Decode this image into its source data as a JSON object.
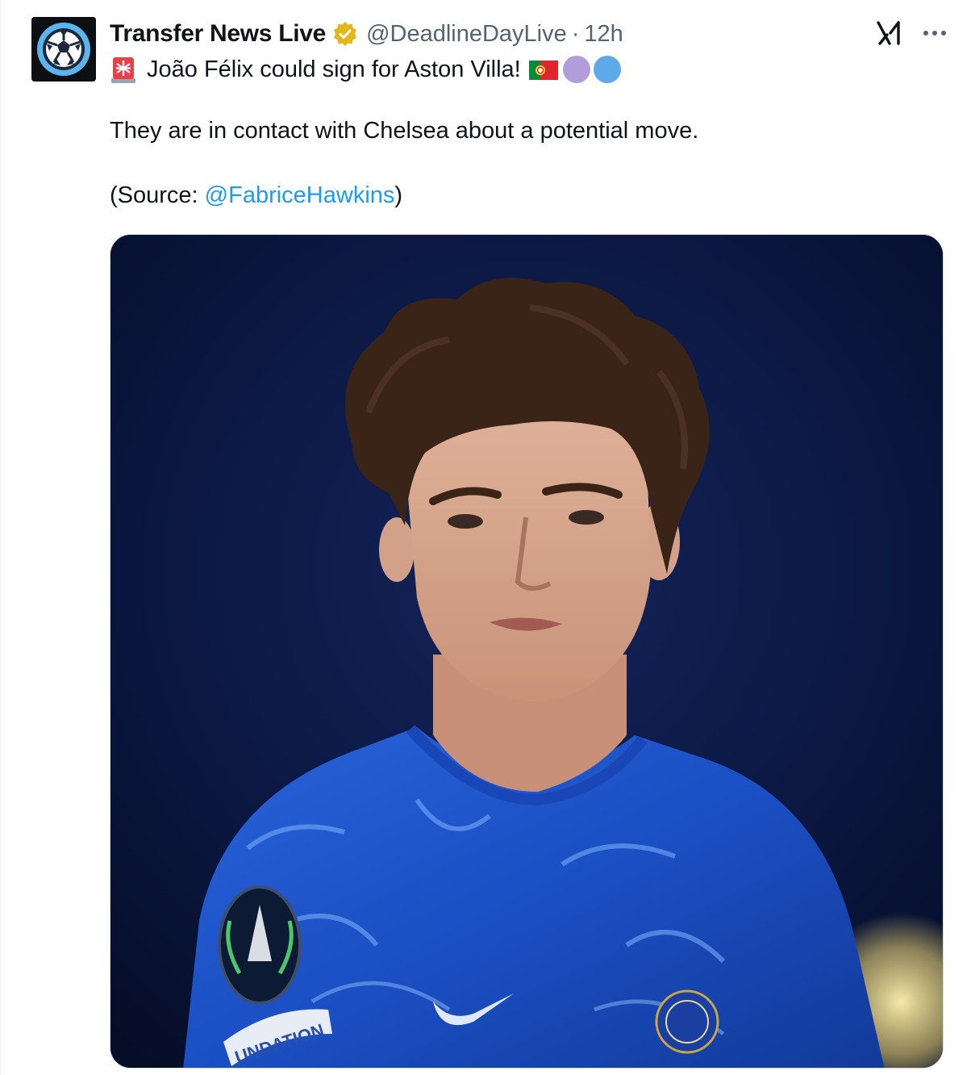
{
  "tweet": {
    "author": {
      "display_name": "Transfer News Live",
      "handle": "@DeadlineDayLive",
      "separator": "·",
      "time": "12h",
      "verified_color": "#e2b719"
    },
    "line1_text": "João Félix could sign for Aston Villa!",
    "paragraph1": "They are in contact with Chelsea about a potential move.",
    "source_prefix": "(Source: ",
    "source_mention": "@FabriceHawkins",
    "source_suffix": ")",
    "icons": [
      "siren-icon",
      "portugal-flag-icon",
      "purple-circle-icon",
      "blue-circle-icon",
      "grok-icon",
      "more-icon",
      "verified-badge-icon"
    ],
    "photo": {
      "patch_text": "UNDATION"
    }
  },
  "colors": {
    "link": "#1d9bf0",
    "secondary_text": "#536471",
    "kit_blue": "#1b4fc4"
  }
}
